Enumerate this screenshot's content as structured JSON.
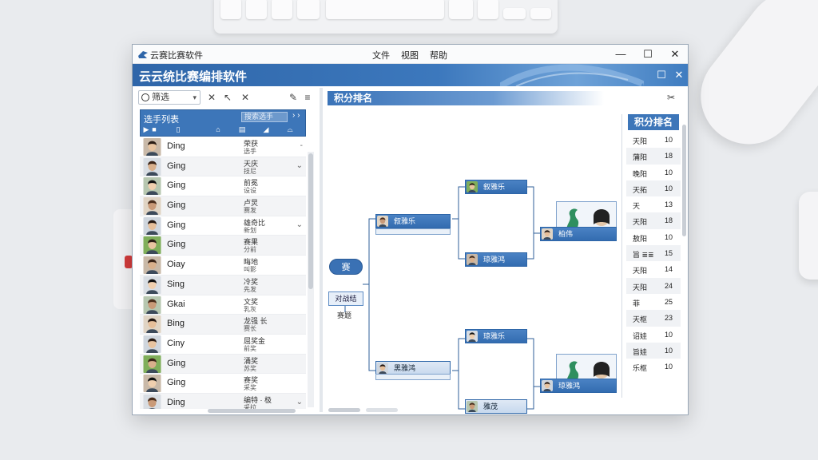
{
  "window": {
    "app_name": "云赛比赛软件",
    "menu": [
      "文件",
      "视图",
      "帮助"
    ],
    "minimize": "—",
    "maximize": "☐",
    "close": "✕",
    "header_title": "云云统比赛编排软件",
    "header_btn_restore": "☐",
    "header_btn_close": "✕"
  },
  "toolbar": {
    "select_value": "筛选",
    "buttons": [
      "✕",
      "↖",
      "✕",
      "✎",
      "≡"
    ]
  },
  "list_header": {
    "title": "选手列表",
    "search_placeholder": "搜索选手",
    "arrow": "› ›"
  },
  "players": [
    {
      "name": "Ding",
      "info1": "荣获",
      "info2": "选手",
      "chev": "-"
    },
    {
      "name": "Ging",
      "info1": "天庆",
      "info2": "技尼",
      "chev": "⌄"
    },
    {
      "name": "Ging",
      "info1": "前冕",
      "info2": "设设",
      "chev": ""
    },
    {
      "name": "Ging",
      "info1": "卢炅",
      "info2": "赛发",
      "chev": ""
    },
    {
      "name": "Ging",
      "info1": "雄奇比",
      "info2": "新划",
      "chev": "⌄"
    },
    {
      "name": "Ging",
      "info1": "赛果",
      "info2": "分前",
      "chev": ""
    },
    {
      "name": "Oiay",
      "info1": "晦地",
      "info2": "叫影",
      "chev": ""
    },
    {
      "name": "Sing",
      "info1": "冷奖",
      "info2": "先发",
      "chev": ""
    },
    {
      "name": "Gkai",
      "info1": "文奖",
      "info2": "乳灰",
      "chev": ""
    },
    {
      "name": "Bing",
      "info1": "龙强 长",
      "info2": "赛长",
      "chev": ""
    },
    {
      "name": "Ciny",
      "info1": "屈奖金",
      "info2": "前奖",
      "chev": ""
    },
    {
      "name": "Ging",
      "info1": "涌奖",
      "info2": "苏奖",
      "chev": ""
    },
    {
      "name": "Ging",
      "info1": "赛奖",
      "info2": "采奖",
      "chev": ""
    },
    {
      "name": "Ding",
      "info1": "编特 · 极",
      "info2": "采拉",
      "chev": "⌄"
    }
  ],
  "main": {
    "section_title": "积分排名",
    "corner_icon": "✂",
    "start_node": "赛",
    "node_label": "对战结",
    "node_sub": "赛题",
    "matches": [
      {
        "label": "叙雅乐"
      },
      {
        "label": "琼雅鸿"
      },
      {
        "label": "琼雅乐"
      },
      {
        "label": "黑雅鸿"
      },
      {
        "label": "雅茂"
      },
      {
        "label": "柏伟"
      }
    ]
  },
  "ranking": {
    "title": "积分排名",
    "rows": [
      {
        "name": "天阳",
        "value": "10"
      },
      {
        "name": "蒲阳",
        "value": "18"
      },
      {
        "name": "晚阳",
        "value": "10"
      },
      {
        "name": "天拓",
        "value": "10"
      },
      {
        "name": "天",
        "value": "13"
      },
      {
        "name": "天阳",
        "value": "18"
      },
      {
        "name": "敖阳",
        "value": "10"
      },
      {
        "name": "旨 ≣≣",
        "value": "15"
      },
      {
        "name": "天阳",
        "value": "14"
      },
      {
        "name": "天阳",
        "value": "24"
      },
      {
        "name": "菲",
        "value": "25"
      },
      {
        "name": "天枢",
        "value": "23"
      },
      {
        "name": "诏娃",
        "value": "10"
      },
      {
        "name": "旨娃",
        "value": "10"
      },
      {
        "name": "乐枢",
        "value": "10"
      }
    ]
  },
  "colors": {
    "accent": "#3d76b9",
    "header_dark": "#2f66a9"
  }
}
